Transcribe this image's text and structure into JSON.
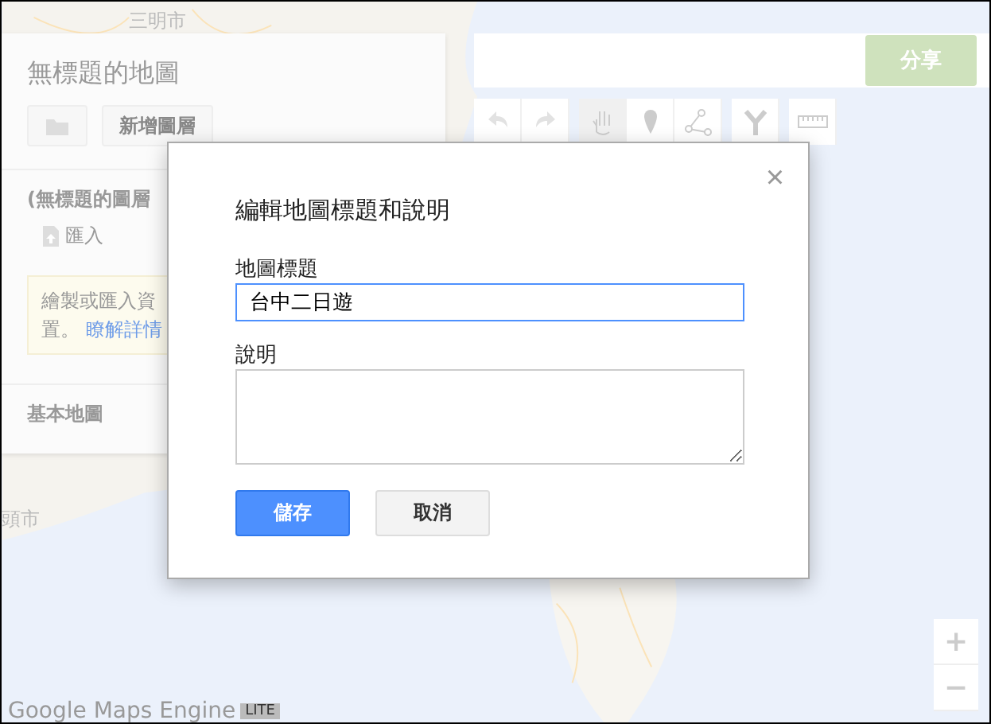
{
  "map": {
    "labels": [
      {
        "text": "三明市",
        "kind": "top"
      },
      {
        "text": "頭市",
        "kind": "left"
      }
    ],
    "attribution": {
      "text": "Google Maps Engine",
      "badge": "LITE"
    }
  },
  "side_panel": {
    "map_title": "無標題的地圖",
    "add_layer_button": "新增圖層",
    "layer": {
      "title": "(無標題的圖層",
      "import_link": "匯入",
      "tip_lines": [
        "繪製或匯入資",
        "置。"
      ],
      "tip_link": "瞭解詳情"
    },
    "base_map": "基本地圖"
  },
  "top_bar": {
    "share_button": "分享",
    "tools": [
      {
        "kind": "undo"
      },
      {
        "kind": "redo"
      },
      {
        "kind": "hand",
        "selected": true
      },
      {
        "kind": "marker",
        "selected": false
      },
      {
        "kind": "line",
        "selected": false
      },
      {
        "kind": "route",
        "selected": false
      },
      {
        "kind": "ruler",
        "selected": false
      }
    ]
  },
  "dialog": {
    "title": "編輯地圖標題和說明",
    "close": "×",
    "fields": [
      {
        "label": "地圖標題",
        "kind": "input",
        "value": "台中二日遊"
      },
      {
        "label": "說明",
        "kind": "textarea"
      }
    ],
    "buttons": [
      {
        "label": "儲存",
        "kind": "primary"
      },
      {
        "label": "取消",
        "kind": "secondary"
      }
    ]
  },
  "zoom": {
    "in": "+",
    "out": "−"
  }
}
